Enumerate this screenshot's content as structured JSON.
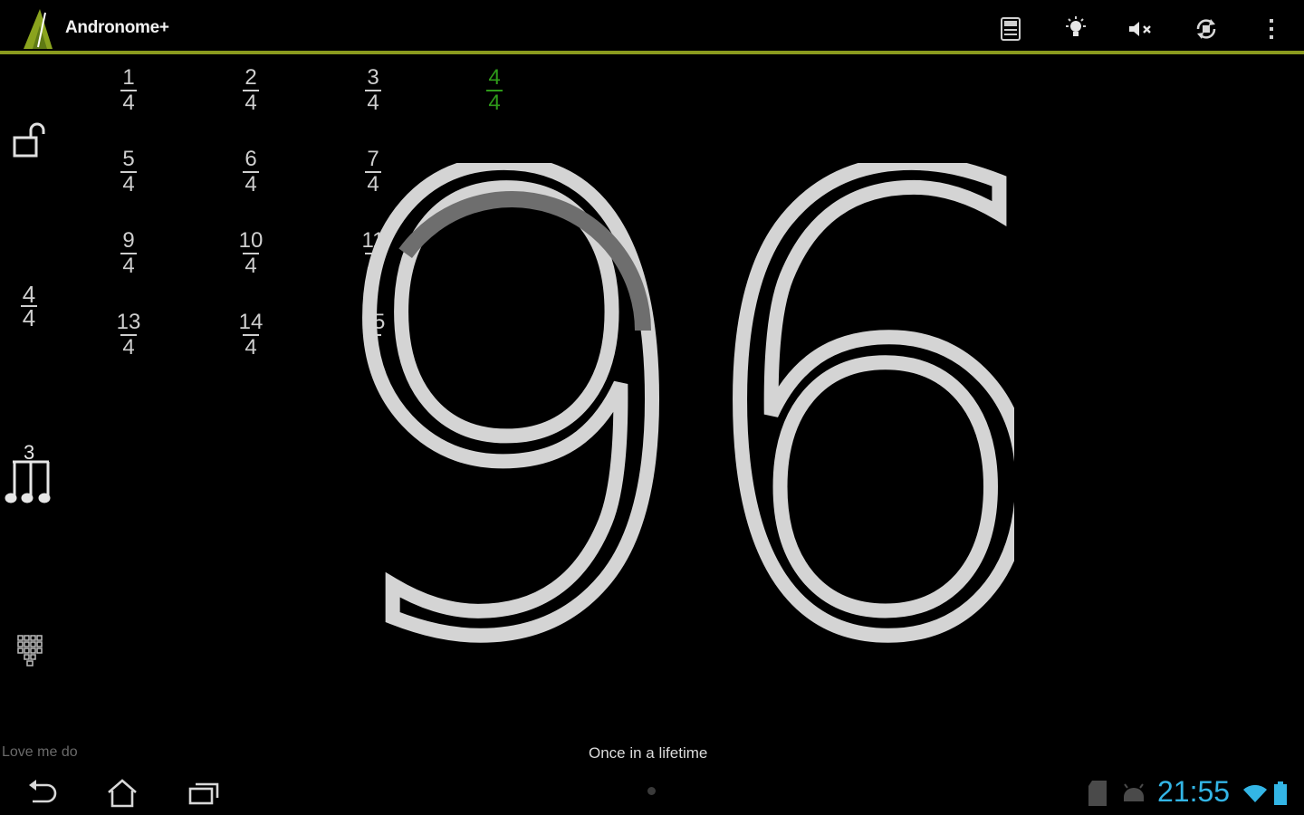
{
  "app": {
    "title": "Andronome+"
  },
  "colors": {
    "accent_bar": "#8a9a1e",
    "selected": "#2e9a19",
    "clock": "#33b5e5",
    "digits": "#d4d4d4"
  },
  "action_bar": {
    "icons": [
      "calculator-icon",
      "light-bulb-icon",
      "volume-mute-icon",
      "rotate-lock-icon",
      "overflow-menu-icon"
    ]
  },
  "left_panel": {
    "lock_icon": "unlock-icon",
    "time_signature": {
      "numerator": "4",
      "denominator": "4"
    },
    "subdivision": {
      "tuplet_label": "3",
      "icon": "triplet-notes-icon"
    },
    "keypad_icon": "keypad-icon"
  },
  "time_signatures": [
    {
      "num": "1",
      "den": "4"
    },
    {
      "num": "2",
      "den": "4"
    },
    {
      "num": "3",
      "den": "4"
    },
    {
      "num": "4",
      "den": "4"
    },
    {
      "num": "5",
      "den": "4"
    },
    {
      "num": "6",
      "den": "4"
    },
    {
      "num": "7",
      "den": "4"
    },
    {
      "num": "9",
      "den": "4"
    },
    {
      "num": "10",
      "den": "4"
    },
    {
      "num": "11",
      "den": "4"
    },
    {
      "num": "13",
      "den": "4"
    },
    {
      "num": "14",
      "den": "4"
    },
    {
      "num": "15",
      "den": "4"
    }
  ],
  "selected_time_signature": "4/4",
  "tempo": {
    "value": "96",
    "beat_progress": 0.25
  },
  "songs": {
    "previous": "Love me do",
    "current": "Once in a lifetime"
  },
  "system_bar": {
    "nav_icons": [
      "back-icon",
      "home-icon",
      "recent-apps-icon"
    ],
    "status_icons": [
      "sd-card-icon",
      "android-debug-icon",
      "wifi-icon",
      "battery-icon"
    ],
    "clock": "21:55"
  }
}
